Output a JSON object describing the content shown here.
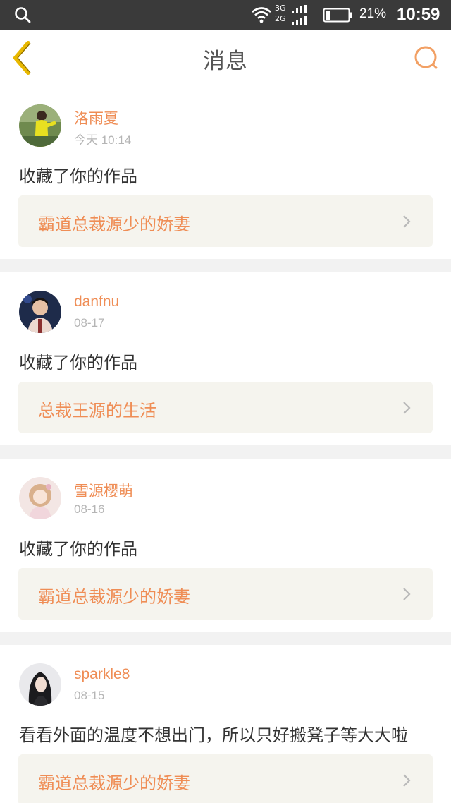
{
  "status_bar": {
    "network_top": "3G",
    "network_bottom": "2G",
    "battery": "21%",
    "time": "10:59"
  },
  "header": {
    "title": "消息"
  },
  "colors": {
    "accent": "#ef8d55",
    "back_icon": "#e8b800",
    "card_link_bg": "#f5f4ee"
  },
  "messages": [
    {
      "username": "洛雨夏",
      "time": "今天 10:14",
      "action": "收藏了你的作品",
      "work_title": "霸道总裁源少的娇妻"
    },
    {
      "username": "danfnu",
      "time": "08-17",
      "action": "收藏了你的作品",
      "work_title": "总裁王源的生活"
    },
    {
      "username": "雪源樱萌",
      "time": "08-16",
      "action": "收藏了你的作品",
      "work_title": "霸道总裁源少的娇妻"
    },
    {
      "username": "sparkle8",
      "time": "08-15",
      "action": "看看外面的温度不想出门，所以只好搬凳子等大大啦",
      "work_title": "霸道总裁源少的娇妻"
    }
  ]
}
